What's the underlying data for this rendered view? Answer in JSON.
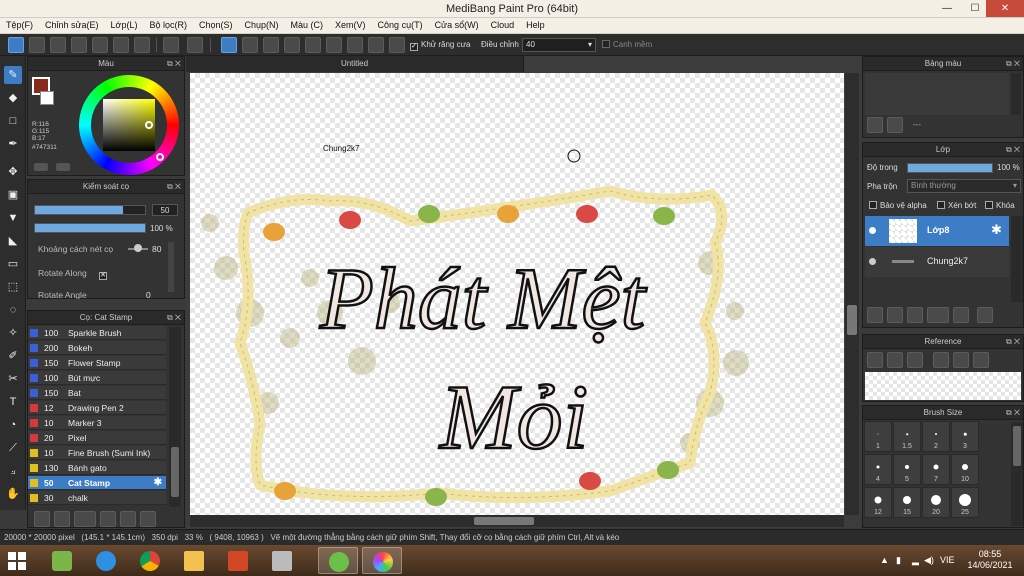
{
  "window": {
    "title": "MediBang Paint Pro (64bit)"
  },
  "menu": [
    "Tệp(F)",
    "Chỉnh sửa(E)",
    "Lớp(L)",
    "Bộ lọc(R)",
    "Chọn(S)",
    "Chụp(N)",
    "Màu (C)",
    "Xem(V)",
    "Công cụ(T)",
    "Cửa sổ(W)",
    "Cloud",
    "Help"
  ],
  "toolbar": {
    "antialias_label": "Khử răng cưa",
    "correction_label": "Điều chỉnh",
    "correction_value": "40",
    "soft_edge_label": "Canh mềm"
  },
  "color_panel": {
    "title": "Màu",
    "rgb": "R:116\nG:115\nB:17",
    "hex": "#747311",
    "fg_color": "#8b2a1c",
    "bg_color": "#ffffff"
  },
  "brush_control": {
    "title": "Kiểm soát cọ",
    "size": "50",
    "size_fraction": 0.8,
    "opacity": "100 %",
    "opacity_fraction": 1.0,
    "spacing_label": "Khoảng cách nét cọ",
    "spacing": "80",
    "rotate_along_label": "Rotate Along",
    "rotate_angle_label": "Rotate Angle",
    "rotate_angle": "0"
  },
  "brush_list": {
    "title": "Cọ: Cat Stamp",
    "items": [
      {
        "size": "100",
        "name": "Sparkle Brush",
        "color": "#3a5fd9"
      },
      {
        "size": "200",
        "name": "Bokeh",
        "color": "#3a5fd9"
      },
      {
        "size": "150",
        "name": "Flower Stamp",
        "color": "#3a5fd9"
      },
      {
        "size": "100",
        "name": "Bút mực",
        "color": "#3a5fd9"
      },
      {
        "size": "150",
        "name": "Bat",
        "color": "#3a5fd9"
      },
      {
        "size": "12",
        "name": "Drawing Pen 2",
        "color": "#d43a3a"
      },
      {
        "size": "10",
        "name": "Marker 3",
        "color": "#d43a3a"
      },
      {
        "size": "20",
        "name": "Pixel",
        "color": "#d43a3a"
      },
      {
        "size": "10",
        "name": "Fine Brush (Sumi Ink)",
        "color": "#e0c020"
      },
      {
        "size": "130",
        "name": "Bánh gato",
        "color": "#e0c020"
      },
      {
        "size": "50",
        "name": "Cat Stamp",
        "color": "#e0c020"
      },
      {
        "size": "30",
        "name": "chalk",
        "color": "#e0c020"
      }
    ]
  },
  "canvas": {
    "tab_title": "Untitled",
    "label_text": "Chung2k7",
    "art_line1": "Phát Mệt",
    "art_line2": "Mỏi"
  },
  "right": {
    "palette_title": "Bảng màu",
    "palette_dash": "---",
    "layer_title": "Lớp",
    "opacity_label": "Độ trong",
    "opacity_value": "100 %",
    "blend_label": "Pha trộn",
    "blend_value": "Bình thường",
    "protect_alpha": "Bảo vệ alpha",
    "clipping": "Xén bớt",
    "lock": "Khóa",
    "layers": [
      {
        "name": "Lớp8"
      },
      {
        "name": "Chung2k7"
      }
    ],
    "reference_title": "Reference",
    "brushsize_title": "Brush Size",
    "brush_sizes": [
      "1",
      "1.5",
      "2",
      "3",
      "4",
      "5",
      "7",
      "10",
      "12",
      "15",
      "20",
      "25"
    ]
  },
  "status": {
    "doc_size": "20000 * 20000 pixel",
    "phys_size": "(145.1 * 145.1cm)",
    "dpi": "350 dpi",
    "zoom": "33 %",
    "coords": "( 9408, 10963 )",
    "hint": "Vẽ một đường thẳng bằng cách giữ phím Shift, Thay đổi cỡ cọ bằng cách giữ phím Ctrl, Alt và kéo"
  },
  "taskbar": {
    "lang": "VIE",
    "time": "08:55",
    "date": "14/06/2021"
  }
}
